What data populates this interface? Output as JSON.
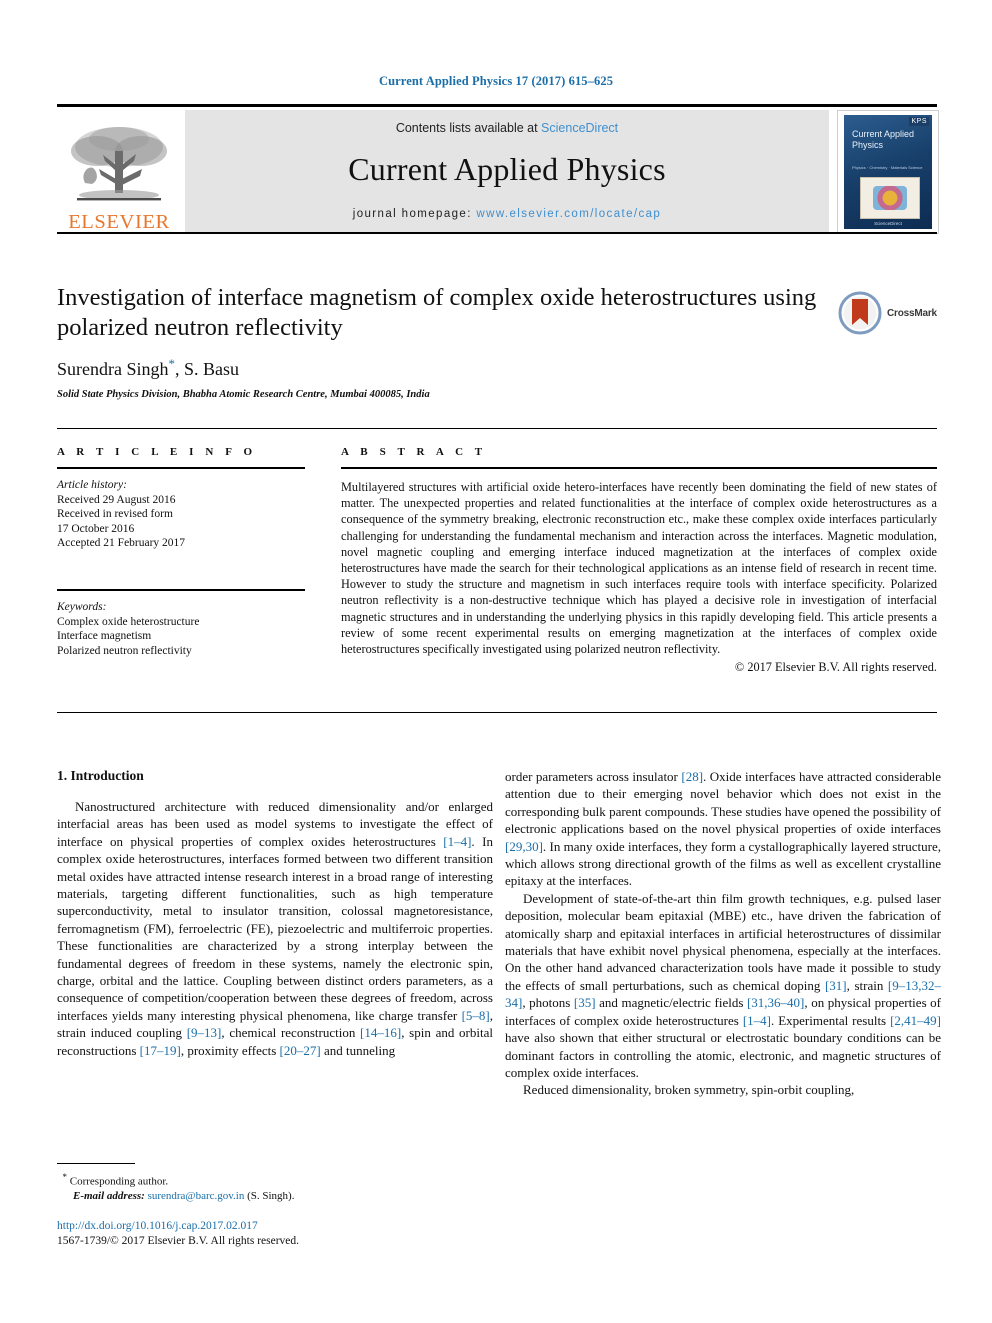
{
  "running_head": "Current Applied Physics 17 (2017) 615–625",
  "masthead": {
    "contents_prefix": "Contents lists available at ",
    "sciencedirect": "ScienceDirect",
    "journal_name": "Current Applied Physics",
    "homepage_prefix": "journal homepage: ",
    "homepage_url": "www.elsevier.com/locate/cap",
    "publisher_logo_text": "ELSEVIER",
    "cover": {
      "badge": "KPS",
      "title": "Current Applied Physics",
      "subtitle": "Physics · Chemistry · Materials Science",
      "footer": "ScienceDirect"
    },
    "link_color": "#3f8fcf"
  },
  "article": {
    "title": "Investigation of interface magnetism of complex oxide heterostructures using polarized neutron reflectivity",
    "authors": "Surendra Singh",
    "authors_tail": ", S. Basu",
    "corresponding_marker": "*",
    "affiliation": "Solid State Physics Division, Bhabha Atomic Research Centre, Mumbai 400085, India",
    "crossmark_label": "CrossMark"
  },
  "info": {
    "heading": "A R T I C L E  I N F O",
    "history_label": "Article history:",
    "history_lines": [
      "Received 29 August 2016",
      "Received in revised form",
      "17 October 2016",
      "Accepted 21 February 2017"
    ],
    "keywords_label": "Keywords:",
    "keywords": [
      "Complex oxide heterostructure",
      "Interface magnetism",
      "Polarized neutron reflectivity"
    ]
  },
  "abstract": {
    "heading": "A B S T R A C T",
    "text": "Multilayered structures with artificial oxide hetero-interfaces have recently been dominating the field of new states of matter. The unexpected properties and related functionalities at the interface of complex oxide heterostructures as a consequence of the symmetry breaking, electronic reconstruction etc., make these complex oxide interfaces particularly challenging for understanding the fundamental mechanism and interaction across the interfaces. Magnetic modulation, novel magnetic coupling and emerging interface induced magnetization at the interfaces of complex oxide heterostructures have made the search for their technological applications as an intense field of research in recent time. However to study the structure and magnetism in such interfaces require tools with interface specificity. Polarized neutron reflectivity is a non-destructive technique which has played a decisive role in investigation of interfacial magnetic structures and in understanding the underlying physics in this rapidly developing field. This article presents a review of some recent experimental results on emerging magnetization at the interfaces of complex oxide heterostructures specifically investigated using polarized neutron reflectivity.",
    "copyright": "© 2017 Elsevier B.V. All rights reserved."
  },
  "body": {
    "section_number_title": "1. Introduction",
    "left_paragraph_1_a": "Nanostructured architecture with reduced dimensionality and/or enlarged interfacial areas has been used as model systems to investigate the effect of interface on physical properties of complex oxides heterostructures ",
    "ref_1_4_a": "[1–4]",
    "left_paragraph_1_b": ". In complex oxide heterostructures, interfaces formed between two different transition metal oxides have attracted intense research interest in a broad range of interesting materials, targeting different functionalities, such as high temperature superconductivity, metal to insulator transition, colossal magnetoresistance, ferromagnetism (FM), ferroelectric (FE), piezoelectric and multiferroic properties. These functionalities are characterized by a strong interplay between the fundamental degrees of freedom in these systems, namely the electronic spin, charge, orbital and the lattice. Coupling between distinct orders parameters, as a consequence of competition/cooperation between these degrees of freedom, across interfaces yields many interesting physical phenomena, like charge transfer ",
    "ref_5_8": "[5–8]",
    "left_paragraph_1_c": ", strain induced coupling ",
    "ref_9_13": "[9–13]",
    "left_paragraph_1_d": ", chemical reconstruction ",
    "ref_14_16": "[14–16]",
    "left_paragraph_1_e": ", spin and orbital reconstructions ",
    "ref_17_19": "[17–19]",
    "left_paragraph_1_f": ", proximity effects ",
    "ref_20_27": "[20–27]",
    "left_paragraph_1_g": " and tunneling",
    "right_paragraph_1_a": "order parameters across insulator ",
    "ref_28": "[28]",
    "right_paragraph_1_b": ". Oxide interfaces have attracted considerable attention due to their emerging novel behavior which does not exist in the corresponding bulk parent compounds. These studies have opened the possibility of electronic applications based on the novel physical properties of oxide interfaces ",
    "ref_29_30": "[29,30]",
    "right_paragraph_1_c": ". In many oxide interfaces, they form a cystallographically layered structure, which allows strong directional growth of the films as well as excellent crystalline epitaxy at the interfaces.",
    "right_paragraph_2_a": "Development of state-of-the-art thin film growth techniques, e.g. pulsed laser deposition, molecular beam epitaxial (MBE) etc., have driven the fabrication of atomically sharp and epitaxial interfaces in artificial heterostructures of dissimilar materials that have exhibit novel physical phenomena, especially at the interfaces. On the other hand advanced characterization tools have made it possible to study the effects of small perturbations, such as chemical doping ",
    "ref_31": "[31]",
    "right_paragraph_2_b": ", strain ",
    "ref_9_13_32_34": "[9–13,32–34]",
    "right_paragraph_2_c": ", photons ",
    "ref_35": "[35]",
    "right_paragraph_2_d": " and magnetic/electric fields ",
    "ref_31_36_40": "[31,36–40]",
    "right_paragraph_2_e": ", on physical properties of interfaces of complex oxide heterostructures ",
    "ref_1_4_b": "[1–4]",
    "right_paragraph_2_f": ". Experimental results ",
    "ref_2_41_49": "[2,41–49]",
    "right_paragraph_2_g": " have also shown that either structural or electrostatic boundary conditions can be dominant factors in controlling the atomic, electronic, and magnetic structures of complex oxide interfaces.",
    "right_paragraph_3": "Reduced dimensionality, broken symmetry, spin-orbit coupling,"
  },
  "footnote": {
    "star": "*",
    "corresponding_author": "Corresponding author.",
    "email_label": "E-mail address:",
    "email": "surendra@barc.gov.in",
    "email_owner": "(S. Singh)."
  },
  "footer": {
    "doi": "http://dx.doi.org/10.1016/j.cap.2017.02.017",
    "issn_line": "1567-1739/© 2017 Elsevier B.V. All rights reserved."
  },
  "colors": {
    "link": "#1a6ea8",
    "elsevier_orange": "#E8772E",
    "band_gray": "#e4e4e4"
  }
}
